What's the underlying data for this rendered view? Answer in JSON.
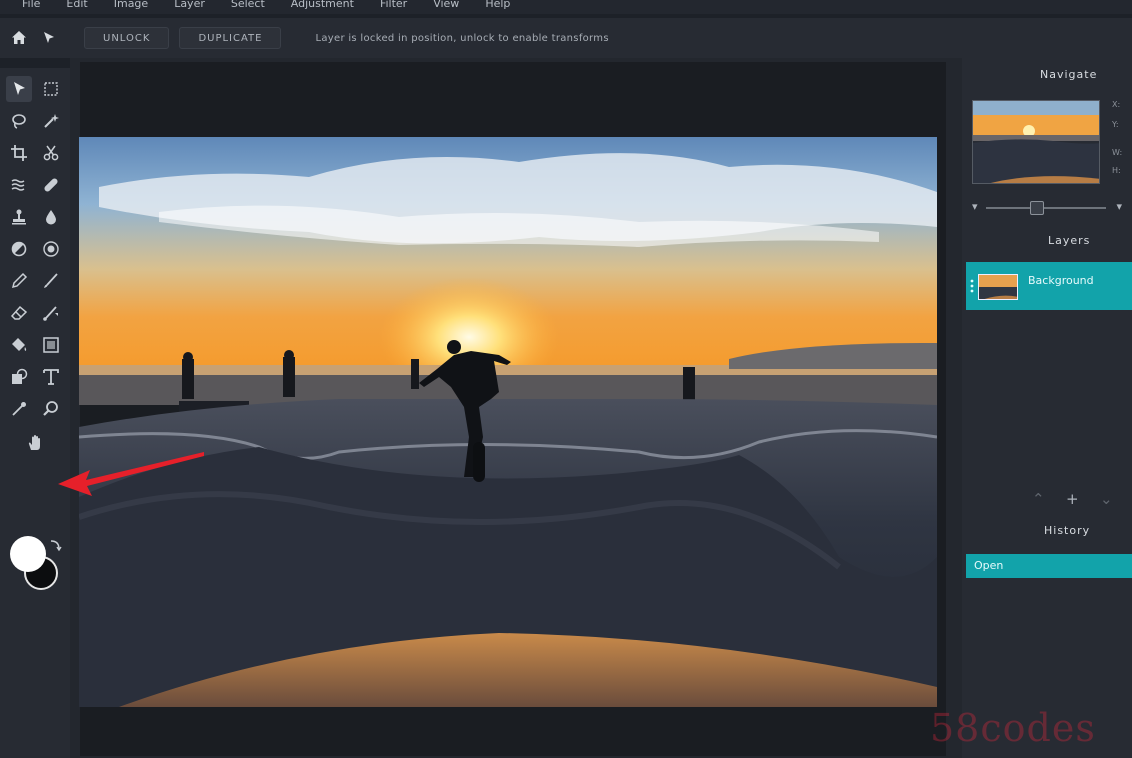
{
  "menu": [
    "File",
    "Edit",
    "Image",
    "Layer",
    "Select",
    "Adjustment",
    "Filter",
    "View",
    "Help"
  ],
  "options_bar": {
    "unlock_label": "UNLOCK",
    "duplicate_label": "DUPLICATE",
    "message": "Layer is locked in position, unlock to enable transforms"
  },
  "tools": [
    "move-tool-icon",
    "marquee-tool-icon",
    "lasso-tool-icon",
    "magic-wand-icon",
    "crop-tool-icon",
    "scissors-icon",
    "smudge-tool-icon",
    "healing-brush-icon",
    "clone-stamp-icon",
    "blur-drop-icon",
    "dodge-burn-icon",
    "sponge-icon",
    "pencil-icon",
    "brush-icon",
    "eraser-icon",
    "color-replace-icon",
    "paint-bucket-icon",
    "gradient-icon",
    "shape-icon",
    "type-tool-icon",
    "eyedropper-icon",
    "zoom-tool-icon",
    "hand-tool-icon"
  ],
  "colors": {
    "foreground": "#ffffff",
    "background": "#0c0d0f",
    "accent": "#12a3aa",
    "arrow": "#e6202a"
  },
  "panels": {
    "navigate": {
      "title": "Navigate",
      "readout": [
        "X:",
        "Y:",
        "W:",
        "H:"
      ]
    },
    "layers": {
      "title": "Layers",
      "items": [
        {
          "name": "Background"
        }
      ]
    },
    "history": {
      "title": "History",
      "items": [
        {
          "name": "Open"
        }
      ]
    }
  },
  "watermark": "58codes"
}
